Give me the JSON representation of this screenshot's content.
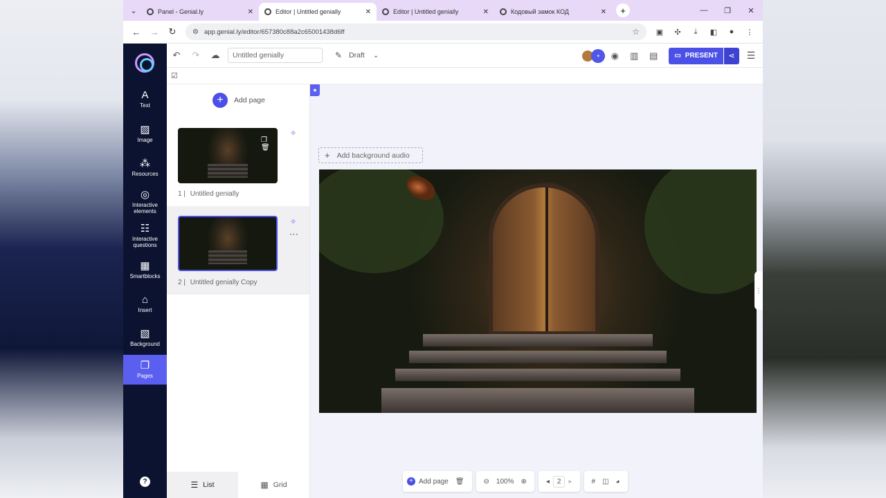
{
  "browser": {
    "tabs": [
      {
        "title": "Panel - Genial.ly"
      },
      {
        "title": "Editor | Untitled genially"
      },
      {
        "title": "Editor | Untitled genially"
      },
      {
        "title": "Кодовый замок КОД"
      }
    ],
    "active_tab": 1,
    "url": "app.genial.ly/editor/657380c88a2c65001438d6ff"
  },
  "editor": {
    "title_value": "Untitled genially",
    "status": "Draft",
    "present_label": "PRESENT"
  },
  "sidebar": {
    "items": [
      {
        "label": "Text",
        "icon": "text-icon"
      },
      {
        "label": "Image",
        "icon": "image-icon"
      },
      {
        "label": "Resources",
        "icon": "resources-icon"
      },
      {
        "label": "Interactive elements",
        "icon": "interactive-elements-icon"
      },
      {
        "label": "Interactive questions",
        "icon": "interactive-questions-icon"
      },
      {
        "label": "Smartblocks",
        "icon": "smartblocks-icon"
      },
      {
        "label": "Insert",
        "icon": "insert-icon"
      },
      {
        "label": "Background",
        "icon": "background-icon"
      },
      {
        "label": "Pages",
        "icon": "pages-icon"
      }
    ],
    "active_item": "Pages"
  },
  "pages_panel": {
    "add_page_label": "Add page",
    "pages": [
      {
        "number": "1 |",
        "name": "Untitled genially"
      },
      {
        "number": "2 |",
        "name": "Untitled genially Copy"
      }
    ],
    "selected_page": 2,
    "view_tabs": [
      {
        "label": "List",
        "icon": "list-icon"
      },
      {
        "label": "Grid",
        "icon": "grid-icon"
      }
    ],
    "active_view": "List"
  },
  "canvas": {
    "add_background_audio_label": "Add background audio"
  },
  "bottom_toolbar": {
    "add_page_label": "Add page",
    "zoom": "100%",
    "page_number": "2"
  },
  "colors": {
    "accent": "#4b50e6",
    "sidebar_bg": "#0c1330",
    "tabbar_bg": "#e7d9f7"
  }
}
